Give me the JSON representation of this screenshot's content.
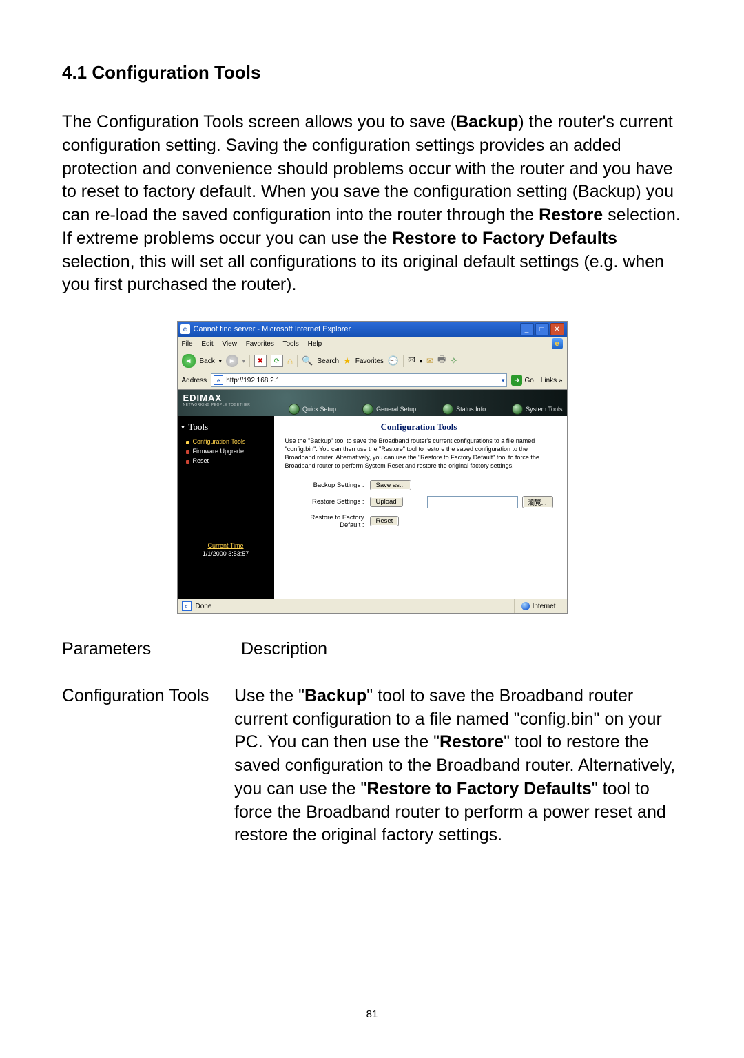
{
  "section": {
    "heading": "4.1 Configuration Tools",
    "intro_before_backup": "The Configuration Tools screen allows you to save (",
    "intro_backup": "Backup",
    "intro_mid1": ") the router's current configuration setting. Saving the configuration settings provides an added protection and convenience should problems occur with the router and you have to reset to factory default. When you save the configuration setting (Backup) you can re-load the saved configuration into the router through the ",
    "intro_restore": "Restore",
    "intro_mid2": " selection. If extreme problems occur you can use the ",
    "intro_rtfd": "Restore to Factory Defaults",
    "intro_end": " selection, this will set all configurations to its original default settings (e.g. when you first purchased the router)."
  },
  "shot": {
    "title": "Cannot find server - Microsoft Internet Explorer",
    "menus": [
      "File",
      "Edit",
      "View",
      "Favorites",
      "Tools",
      "Help"
    ],
    "back": "Back",
    "search": "Search",
    "favorites": "Favorites",
    "address_label": "Address",
    "address_value": "http://192.168.2.1",
    "go": "Go",
    "links": "Links",
    "logo": "EDIMAX",
    "logo_sub": "NETWORKING PEOPLE TOGETHER",
    "banner_nav": [
      "Quick Setup",
      "General Setup",
      "Status Info",
      "System Tools"
    ],
    "side_title": "Tools",
    "side_items": [
      "Configuration Tools",
      "Firmware Upgrade",
      "Reset"
    ],
    "current_time_label": "Current Time",
    "current_time_value": "1/1/2000 3:53:57",
    "content_title": "Configuration Tools",
    "content_desc": "Use the \"Backup\" tool to save the Broadband router's current configurations to a file named \"config.bin\". You can then use the \"Restore\" tool to restore the saved configuration to the Broadband router. Alternatively, you can use the \"Restore to Factory Default\" tool to force the Broadband router to perform System Reset and restore the original factory settings.",
    "rows": {
      "backup_label": "Backup Settings :",
      "backup_btn": "Save as...",
      "restore_label": "Restore Settings :",
      "restore_btn": "Upload",
      "browse_btn": "瀏覽...",
      "rtfd_label1": "Restore to Factory",
      "rtfd_label2": "Default :",
      "rtfd_btn": "Reset"
    },
    "status_done": "Done",
    "status_zone": "Internet"
  },
  "params": {
    "hdr_param": "Parameters",
    "hdr_desc": "Description",
    "row_param": "Configuration Tools",
    "desc_p1a": "Use the \"",
    "desc_backup": "Backup",
    "desc_p1b": "\" tool to save the Broadband router current configuration to a file named \"config.bin\" on your PC. You can then use the \"",
    "desc_restore": "Restore",
    "desc_p1c": "\" tool to restore the saved configuration to the Broadband router. Alternatively, you can use the \"",
    "desc_rtfd": "Restore to Factory Defaults",
    "desc_p1d": "\" tool to force the Broadband router to perform a power reset and restore the original factory settings."
  },
  "page_number": "81"
}
